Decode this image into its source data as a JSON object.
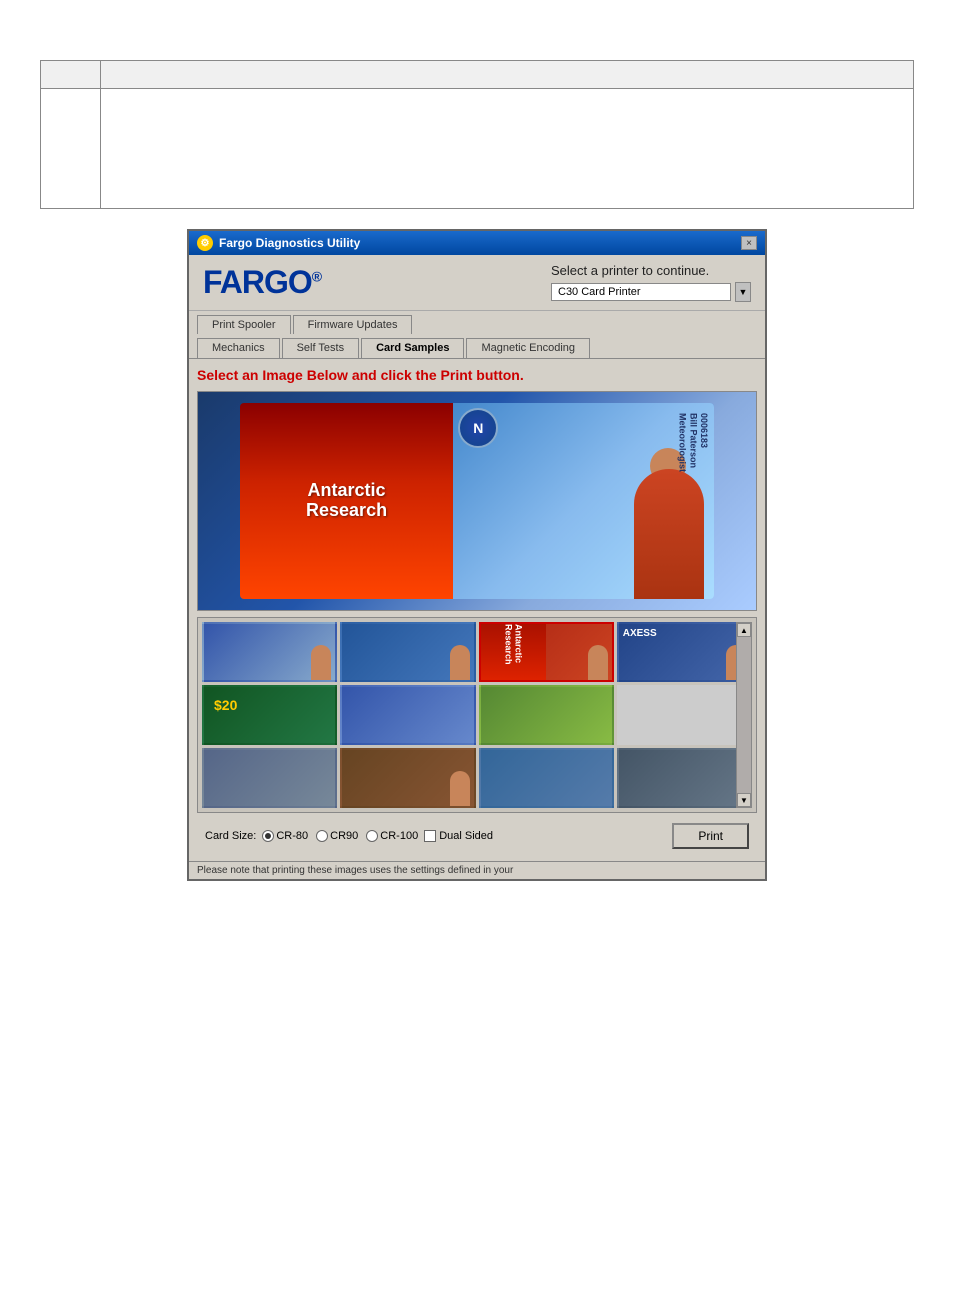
{
  "doc": {
    "table": {
      "header": {
        "col1": "",
        "col2": ""
      },
      "row": {
        "col1": "",
        "col2": ""
      }
    }
  },
  "window": {
    "title": "Fargo Diagnostics Utility",
    "close_label": "×"
  },
  "header": {
    "logo": "FARGO",
    "logo_reg": "®",
    "printer_select_label": "Select a printer to continue.",
    "printer_name": "C30 Card Printer"
  },
  "tabs_row1": {
    "tab1": "Print Spooler",
    "tab2": "Firmware Updates"
  },
  "tabs_row2": {
    "tab1": "Mechanics",
    "tab2": "Self Tests",
    "tab3": "Card Samples",
    "tab4": "Magnetic Encoding"
  },
  "content": {
    "instruction": "Select an Image Below and click the Print button."
  },
  "card_preview": {
    "antarctic_line1": "Antarctic",
    "antarctic_line2": "Research",
    "compass_letter": "N",
    "person_id": "0006183",
    "person_name": "Bill Paterson",
    "person_title": "Meteorologist"
  },
  "thumbnails": {
    "items": [
      {
        "id": 1,
        "label": "thumb-1"
      },
      {
        "id": 2,
        "label": "thumb-2"
      },
      {
        "id": 3,
        "label": "thumb-3",
        "selected": true
      },
      {
        "id": 4,
        "label": "thumb-4"
      },
      {
        "id": 5,
        "label": "thumb-5"
      },
      {
        "id": 6,
        "label": "thumb-6"
      },
      {
        "id": 7,
        "label": "thumb-7"
      },
      {
        "id": 8,
        "label": "thumb-8"
      }
    ]
  },
  "bottom": {
    "card_size_label": "Card Size:",
    "cr80_label": "CR-80",
    "cr90_label": "CR90",
    "cr100_label": "CR-100",
    "dual_sided_label": "Dual Sided",
    "print_label": "Print"
  },
  "status_bar": {
    "text": "Please note that printing these images uses the settings defined in your"
  },
  "scroll": {
    "up": "▲",
    "down": "▼"
  }
}
